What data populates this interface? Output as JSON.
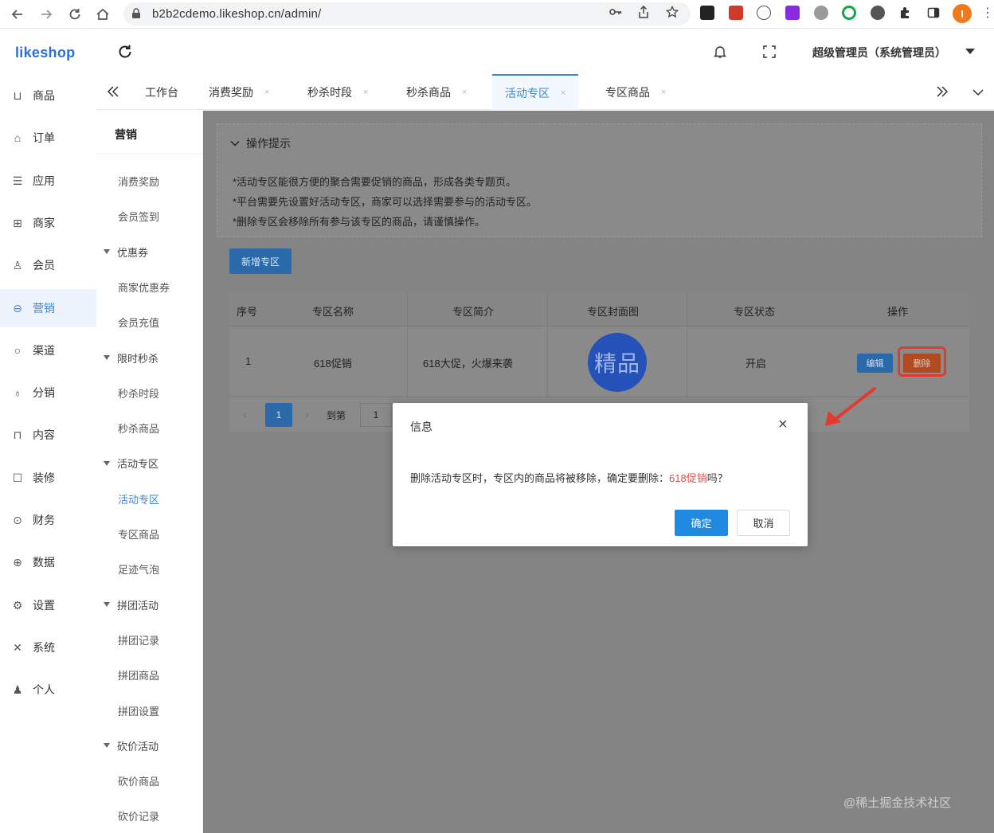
{
  "browser": {
    "url": "b2b2cdemo.likeshop.cn/admin/",
    "profile_initial": "I"
  },
  "header": {
    "logo": "likeshop",
    "user": "超级管理员（系统管理员）"
  },
  "main_menu": [
    {
      "icon": "cart-icon",
      "label": "商品"
    },
    {
      "icon": "bell-icon",
      "label": "订单"
    },
    {
      "icon": "list-icon",
      "label": "应用"
    },
    {
      "icon": "shop-icon",
      "label": "商家"
    },
    {
      "icon": "person-icon",
      "label": "会员"
    },
    {
      "icon": "marketing-icon",
      "label": "营销",
      "active": true
    },
    {
      "icon": "channel-icon",
      "label": "渠道"
    },
    {
      "icon": "distribution-icon",
      "label": "分销"
    },
    {
      "icon": "book-icon",
      "label": "内容"
    },
    {
      "icon": "decor-icon",
      "label": "装修"
    },
    {
      "icon": "finance-icon",
      "label": "财务"
    },
    {
      "icon": "data-icon",
      "label": "数据"
    },
    {
      "icon": "settings-icon",
      "label": "设置"
    },
    {
      "icon": "system-icon",
      "label": "系统"
    },
    {
      "icon": "user-icon",
      "label": "个人"
    }
  ],
  "tabs": [
    {
      "label": "工作台"
    },
    {
      "label": "消费奖励"
    },
    {
      "label": "秒杀时段"
    },
    {
      "label": "秒杀商品"
    },
    {
      "label": "活动专区",
      "active": true
    },
    {
      "label": "专区商品"
    }
  ],
  "sub_menu": {
    "title": "营销",
    "items": [
      {
        "label": "消费奖励",
        "type": "item"
      },
      {
        "label": "会员签到",
        "type": "item"
      },
      {
        "label": "优惠券",
        "type": "group"
      },
      {
        "label": "商家优惠券",
        "type": "item"
      },
      {
        "label": "会员充值",
        "type": "item"
      },
      {
        "label": "限时秒杀",
        "type": "group"
      },
      {
        "label": "秒杀时段",
        "type": "item"
      },
      {
        "label": "秒杀商品",
        "type": "item"
      },
      {
        "label": "活动专区",
        "type": "group"
      },
      {
        "label": "活动专区",
        "type": "item",
        "active": true
      },
      {
        "label": "专区商品",
        "type": "item"
      },
      {
        "label": "足迹气泡",
        "type": "item"
      },
      {
        "label": "拼团活动",
        "type": "group"
      },
      {
        "label": "拼团记录",
        "type": "item"
      },
      {
        "label": "拼团商品",
        "type": "item"
      },
      {
        "label": "拼团设置",
        "type": "item"
      },
      {
        "label": "砍价活动",
        "type": "group"
      },
      {
        "label": "砍价商品",
        "type": "item"
      },
      {
        "label": "砍价记录",
        "type": "item"
      }
    ]
  },
  "tips": {
    "title": "操作提示",
    "lines": [
      "*活动专区能很方便的聚合需要促销的商品，形成各类专题页。",
      "*平台需要先设置好活动专区，商家可以选择需要参与的活动专区。",
      "*删除专区会移除所有参与该专区的商品，请谨慎操作。"
    ]
  },
  "add_button": "新增专区",
  "table": {
    "headers": [
      "序号",
      "专区名称",
      "专区简介",
      "专区封面图",
      "专区状态",
      "操作"
    ],
    "rows": [
      {
        "index": "1",
        "name": "618促销",
        "intro": "618大促，火爆来袭",
        "cover_text": "精品",
        "status": "开启",
        "edit": "编辑",
        "delete": "删除"
      }
    ]
  },
  "pagination": {
    "current": "1",
    "goto_label": "到第",
    "goto_value": "1"
  },
  "dialog": {
    "title": "信息",
    "message_prefix": "删除活动专区时，专区内的商品将被移除，确定要删除：",
    "message_highlight": "618促销",
    "message_suffix": "吗？",
    "confirm": "确定",
    "cancel": "取消"
  },
  "watermark": "@稀土掘金技术社区",
  "colors": {
    "accent": "#3a86d8",
    "primary_button": "#1f8ae0",
    "danger_highlight": "#e23b2e",
    "overlay": "#848484"
  }
}
